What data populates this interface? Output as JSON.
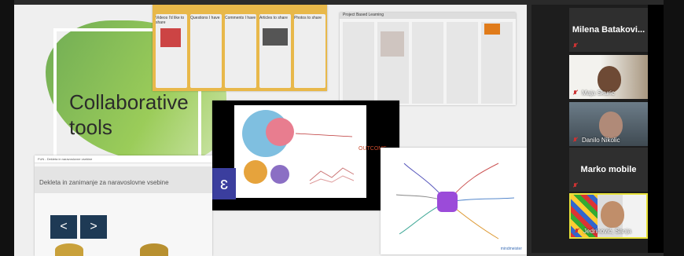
{
  "slide": {
    "title_line1": "Collaborative",
    "title_line2": "tools"
  },
  "thumbnails": {
    "trello_headers": [
      "Videos I'd like to share",
      "Questions I have",
      "Comments I have",
      "Articles to share",
      "Photos to share"
    ],
    "board2_title": "Project Based Learning",
    "mindmeister_outcome": "OUTCOME",
    "mindmeister_logo": "ɛ",
    "doc_title": "Dekleta in zanimanje za naravoslovne vsebine",
    "doc_top": "FUN - Dekleta in naravoslovne vsebine",
    "doc_prev": "<",
    "doc_next": ">",
    "mindmap_brand": "mindmeister"
  },
  "participants": [
    {
      "name": "Milena Batakovi...",
      "type": "name-only"
    },
    {
      "name": "Maja Skuric",
      "type": "video"
    },
    {
      "name": "Danilo Nikolic",
      "type": "video"
    },
    {
      "name": "Marko mobile",
      "type": "name-only"
    },
    {
      "name": "Jedrinović, Sanja",
      "type": "video",
      "active": true
    }
  ],
  "colors": {
    "accent_green": "#6fb23f",
    "active_speaker": "#e8e23a",
    "mic_muted": "#cc3333"
  }
}
